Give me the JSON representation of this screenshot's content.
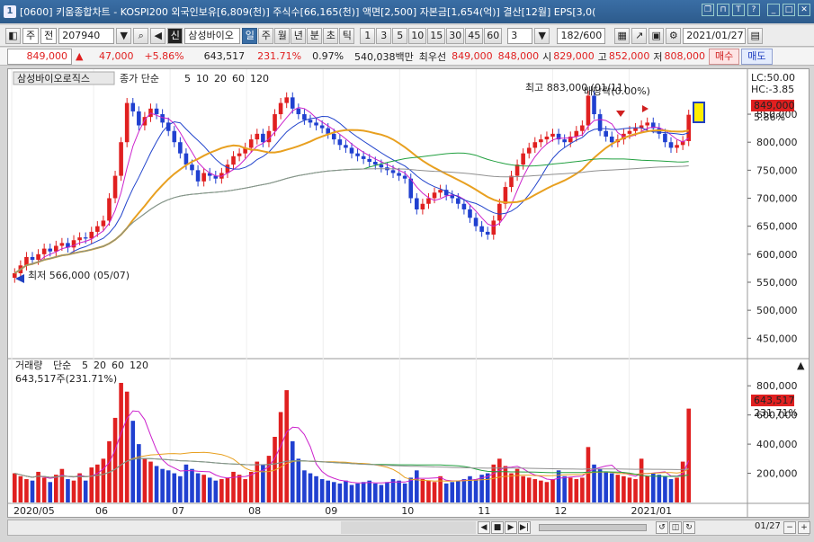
{
  "window": {
    "title": "[0600] 키움종합차트 - KOSPI200 외국인보유[6,809(천)] 주식수[66,165(천)] 액면[2,500] 자본금[1,654(억)] 결산[12월] EPS[3,0(",
    "number": "1"
  },
  "toolbar": {
    "period_mode": "주",
    "mode2": "전",
    "code": "207940",
    "stock_name": "삼성바이오",
    "stock_flag": "신",
    "intervals": [
      "일",
      "주",
      "월",
      "년",
      "분",
      "초",
      "틱"
    ],
    "minute_options": [
      "1",
      "3",
      "5",
      "10",
      "15",
      "30",
      "45",
      "60"
    ],
    "selected_interval": "일",
    "custom_value": "3",
    "count": "182/600",
    "date": "2021/01/27"
  },
  "pricebar": {
    "price": "849,000",
    "change_arrow": "▲",
    "change": "47,000",
    "change_rate": "+5.86%",
    "volume": "643,517",
    "volume_rate": "231.71%",
    "turnover": "0.97%",
    "trade_amount": "540,038백만",
    "quote_label": "최우선",
    "ask": "849,000",
    "bid": "848,000",
    "open_label": "시",
    "open": "829,000",
    "high_label": "고",
    "high": "852,000",
    "low_label": "저",
    "low": "808,000",
    "buy_label": "매수",
    "sell_label": "매도"
  },
  "price_panel": {
    "title": "삼성바이오로직스",
    "legend_prefix": "종가 단순",
    "ma": [
      "5",
      "10",
      "20",
      "60",
      "120"
    ],
    "ma_colors": [
      "#cc22cc",
      "#2244cc",
      "#e8a020",
      "#22a040",
      "#909090"
    ],
    "lc": "LC:50.00",
    "hc": "HC:-3.85",
    "current_price": "849,000",
    "current_rate": "5.86%",
    "high_annotation": "최고 883,000 (01/11)",
    "low_annotation": "최저 566,000 (05/07)",
    "dividend_annotation": "배당락(0.00%)",
    "yticks": [
      "850,000",
      "800,000",
      "750,000",
      "700,000",
      "650,000",
      "600,000",
      "550,000",
      "500,000",
      "450,000"
    ]
  },
  "volume_panel": {
    "title": "거래량",
    "legend_prefix": "단순",
    "ma": [
      "5",
      "20",
      "60",
      "120"
    ],
    "ma_colors": [
      "#cc22cc",
      "#e8a020",
      "#22a040",
      "#909090"
    ],
    "current_volume_text": "643,517주(231.71%)",
    "current_volume": "643,517",
    "current_rate": "231.71%",
    "yticks": [
      "800,000",
      "600,000",
      "400,000",
      "200,000"
    ]
  },
  "xaxis": {
    "labels": [
      "2020/05",
      "06",
      "07",
      "08",
      "09",
      "10",
      "11",
      "12",
      "2021/01"
    ],
    "end_label": "01/27"
  },
  "chart_data": {
    "type": "candlestick",
    "y_range": [
      420000,
      895000
    ],
    "volume_range": [
      0,
      900000
    ],
    "closes": [
      566000,
      580000,
      595000,
      590000,
      600000,
      610000,
      605000,
      615000,
      620000,
      612000,
      625000,
      630000,
      628000,
      640000,
      650000,
      660000,
      700000,
      740000,
      800000,
      870000,
      855000,
      830000,
      845000,
      860000,
      850000,
      835000,
      820000,
      800000,
      780000,
      760000,
      750000,
      730000,
      745000,
      740000,
      735000,
      745000,
      760000,
      775000,
      780000,
      790000,
      805000,
      815000,
      800000,
      820000,
      850000,
      870000,
      880000,
      860000,
      850000,
      840000,
      835000,
      830000,
      825000,
      815000,
      805000,
      795000,
      790000,
      780000,
      775000,
      770000,
      765000,
      760000,
      755000,
      750000,
      745000,
      740000,
      735000,
      700000,
      680000,
      690000,
      700000,
      710000,
      715000,
      705000,
      700000,
      690000,
      680000,
      665000,
      650000,
      640000,
      635000,
      660000,
      690000,
      720000,
      740000,
      760000,
      780000,
      790000,
      800000,
      805000,
      810000,
      815000,
      805000,
      800000,
      810000,
      820000,
      830000,
      883000,
      850000,
      820000,
      810000,
      800000,
      805000,
      815000,
      820000,
      825000,
      830000,
      835000,
      825000,
      815000,
      800000,
      790000,
      795000,
      802000,
      849000
    ],
    "volumes": [
      200000,
      180000,
      160000,
      150000,
      210000,
      170000,
      140000,
      190000,
      230000,
      160000,
      150000,
      200000,
      150000,
      240000,
      260000,
      300000,
      420000,
      580000,
      820000,
      760000,
      560000,
      400000,
      300000,
      280000,
      250000,
      230000,
      220000,
      200000,
      180000,
      260000,
      230000,
      200000,
      190000,
      170000,
      150000,
      160000,
      170000,
      210000,
      190000,
      160000,
      210000,
      280000,
      260000,
      320000,
      450000,
      620000,
      770000,
      420000,
      300000,
      220000,
      200000,
      180000,
      160000,
      150000,
      140000,
      130000,
      150000,
      120000,
      130000,
      140000,
      150000,
      130000,
      120000,
      140000,
      160000,
      150000,
      130000,
      170000,
      220000,
      160000,
      150000,
      140000,
      180000,
      130000,
      140000,
      150000,
      160000,
      180000,
      160000,
      190000,
      200000,
      260000,
      300000,
      250000,
      200000,
      230000,
      180000,
      170000,
      160000,
      150000,
      140000,
      160000,
      220000,
      180000,
      170000,
      160000,
      170000,
      380000,
      260000,
      230000,
      210000,
      200000,
      190000,
      180000,
      170000,
      160000,
      300000,
      180000,
      200000,
      190000,
      180000,
      160000,
      170000,
      280000,
      643517
    ]
  }
}
